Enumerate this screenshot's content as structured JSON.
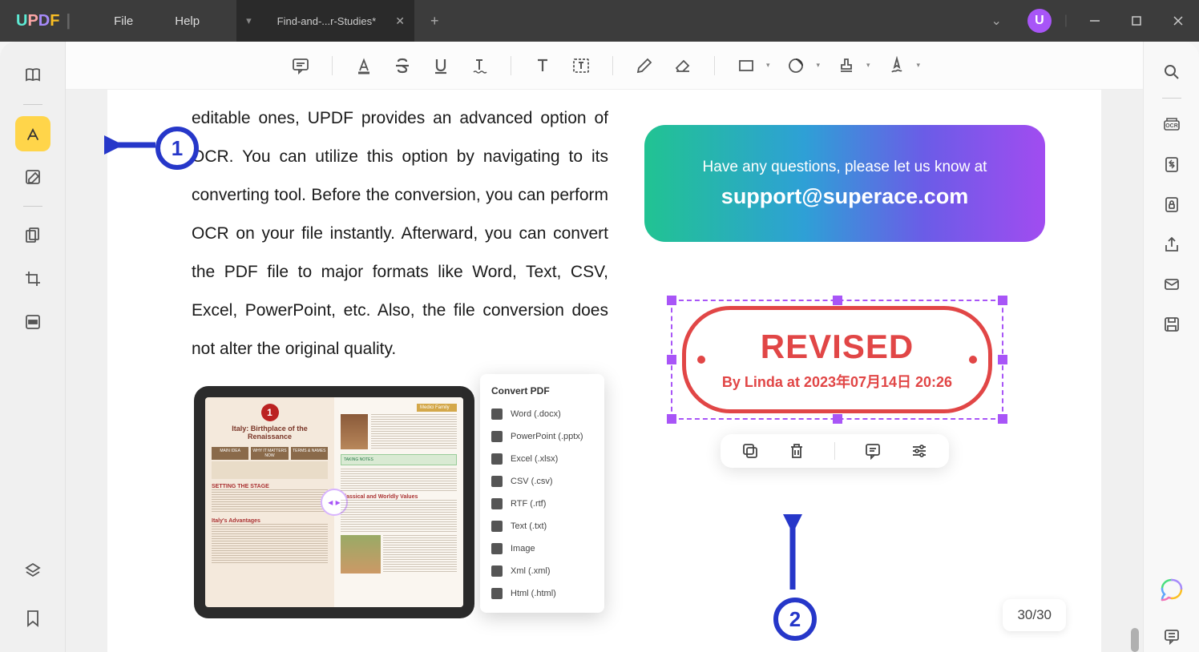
{
  "titlebar": {
    "menus": {
      "file": "File",
      "help": "Help"
    },
    "tab_title": "Find-and-...r-Studies*",
    "avatar_letter": "U"
  },
  "toolbar": {
    "items": [
      "sticky-note",
      "highlighter",
      "strikethrough",
      "underline",
      "squiggly",
      "text",
      "text-box",
      "pencil",
      "eraser",
      "rectangle",
      "circle",
      "stamp",
      "signature"
    ]
  },
  "document": {
    "body_text": "editable ones, UPDF provides an advanced option of OCR. You can utilize this option by navigating to its converting tool. Before the conversion, you can perform OCR on your file instantly. Afterward, you can convert the PDF file to major formats like Word, Text, CSV, Excel, PowerPoint, etc. Also, the file conversion does not alter the original quality.",
    "support_box": {
      "line1": "Have any questions, please let us know at",
      "email": "support@superace.com"
    },
    "stamp": {
      "title": "REVISED",
      "byline": "By Linda at 2023年07月14日 20:26"
    }
  },
  "convert_popup": {
    "title": "Convert PDF",
    "items": [
      "Word (.docx)",
      "PowerPoint (.pptx)",
      "Excel (.xlsx)",
      "CSV (.csv)",
      "RTF (.rtf)",
      "Text (.txt)",
      "Image",
      "Xml (.xml)",
      "Html (.html)"
    ]
  },
  "convert_image": {
    "headline": "Italy: Birthplace of the Renaissance",
    "number": "1"
  },
  "callouts": {
    "one": "1",
    "two": "2"
  },
  "page_indicator": "30/30"
}
